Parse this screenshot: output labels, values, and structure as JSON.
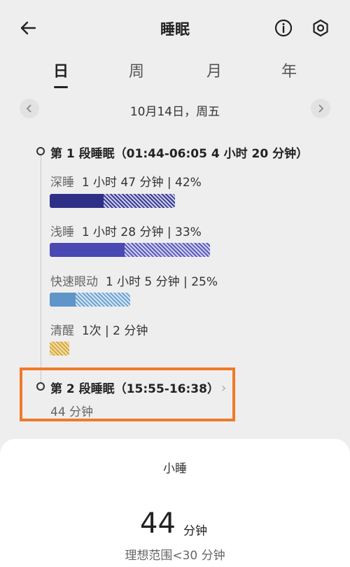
{
  "header": {
    "title": "睡眠",
    "back_icon": "arrow-left-icon",
    "info_icon": "info-icon",
    "settings_icon": "settings-icon"
  },
  "tabs": [
    {
      "label": "日",
      "active": true
    },
    {
      "label": "周"
    },
    {
      "label": "月"
    },
    {
      "label": "年"
    }
  ],
  "date": {
    "label": "10月14日，周五"
  },
  "segments": [
    {
      "title": "第 1 段睡眠（01:44-06:05  4 小时 20 分钟）"
    },
    {
      "title": "第 2 段睡眠（15:55-16:38）",
      "duration": "44 分钟"
    }
  ],
  "stages": [
    {
      "name": "深睡",
      "detail": "1 小时 47 分钟 | 42%",
      "color": "#2e2f86",
      "hatch": "#3a3b9a"
    },
    {
      "name": "浅睡",
      "detail": "1 小时 28 分钟 | 33%",
      "color": "#4a48b3",
      "hatch": "#5a59c0"
    },
    {
      "name": "快速眼动",
      "detail": "1 小时 5 分钟 | 25%",
      "color": "#5f95c9",
      "hatch": "#6ca3d3"
    },
    {
      "name": "清醒",
      "detail": "1次 | 2 分钟",
      "color": "#d9a93a",
      "hatch": "#d9a93a"
    }
  ],
  "sheet": {
    "title": "小睡",
    "value": "44",
    "unit": "分钟",
    "range": "理想范围<30 分钟"
  }
}
